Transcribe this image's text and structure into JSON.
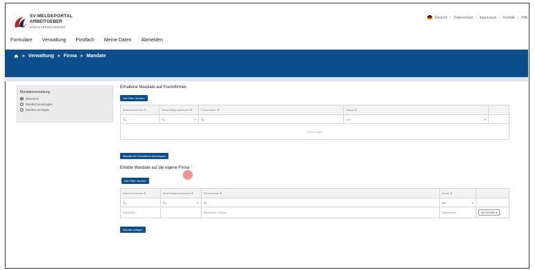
{
  "header": {
    "logo_line1": "SV-MELDEPORTAL",
    "logo_line2": "ARBEITGEBER",
    "logo_line3": "SOZIALVERSICHERUNG",
    "top_links": [
      "Deutsch",
      "Datenschutz",
      "Impressum",
      "Kontakt",
      "Hilfe"
    ]
  },
  "nav": [
    "Formulare",
    "Verwaltung",
    "Postfach",
    "Meine Daten",
    "Abmelden"
  ],
  "breadcrumb": [
    "Verwaltung",
    "Firma",
    "Mandate"
  ],
  "sidebar": {
    "title": "Mandatsverwaltung",
    "items": [
      {
        "label": "Übersicht",
        "selected": true
      },
      {
        "label": "Mandat beantragen",
        "selected": false
      },
      {
        "label": "Mandat anzeigen",
        "selected": false
      }
    ]
  },
  "received": {
    "title": "Erhaltene Mandate auf Fremdfirmen",
    "filter_button": "Alle Filter löschen",
    "columns": [
      "Betriebsnummer ⇅",
      "Beschäftigungsbetrieb ⇅",
      "Firmenname ⇅",
      "Status ⇅"
    ],
    "status_filter": "Alle",
    "empty_text": "Keine Daten",
    "action_button": "Mandat für Fremdfirma beantragen"
  },
  "issued": {
    "title": "Erteilte Mandate auf die eigene Firma",
    "filter_button": "Alle Filter löschen",
    "columns": [
      "Betriebsnummer ⇅",
      "Beschäftigungsbetrieb ⇅",
      "Firmenname ⇅",
      "Status ⇅"
    ],
    "status_filter": "Alle",
    "row": {
      "betriebsnummer": "98301912",
      "beschaeftigung": "",
      "firmenname": "Steuerbüro Fischer",
      "status": "Zugestimmt",
      "action": "AKTIONEN"
    },
    "action_button": "Mandat anlegen"
  },
  "colors": {
    "brand": "#0b4e8c",
    "accent_cursor": "#f08080"
  }
}
